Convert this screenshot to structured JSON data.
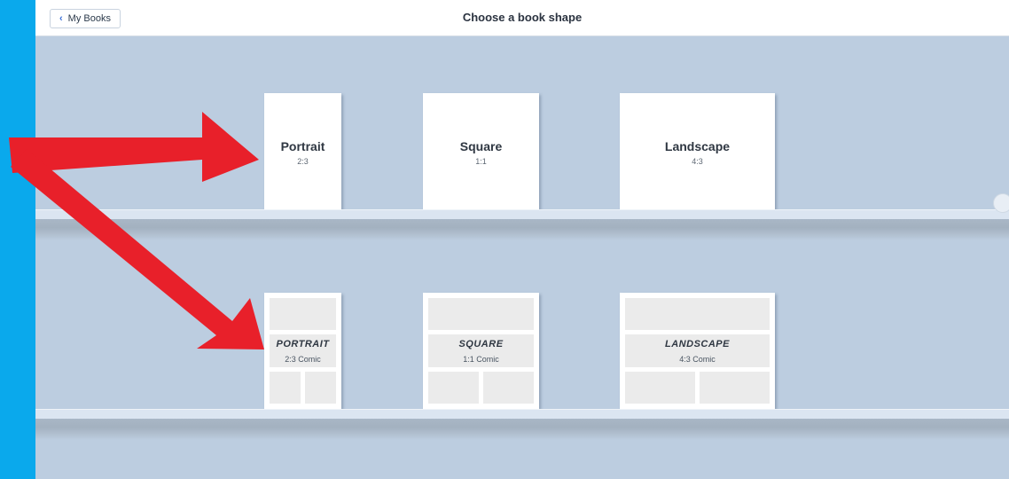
{
  "topbar": {
    "back_label": "My Books",
    "title": "Choose a book shape"
  },
  "standard_books": [
    {
      "name": "Portrait",
      "ratio": "2:3"
    },
    {
      "name": "Square",
      "ratio": "1:1"
    },
    {
      "name": "Landscape",
      "ratio": "4:3"
    }
  ],
  "comic_books": [
    {
      "name": "PORTRAIT",
      "ratio": "2:3 Comic"
    },
    {
      "name": "SQUARE",
      "ratio": "1:1 Comic"
    },
    {
      "name": "LANDSCAPE",
      "ratio": "4:3 Comic"
    }
  ],
  "colors": {
    "outer_background": "#0aa9ec",
    "shelf_background": "#bccde0",
    "arrow": "#e8202a"
  }
}
